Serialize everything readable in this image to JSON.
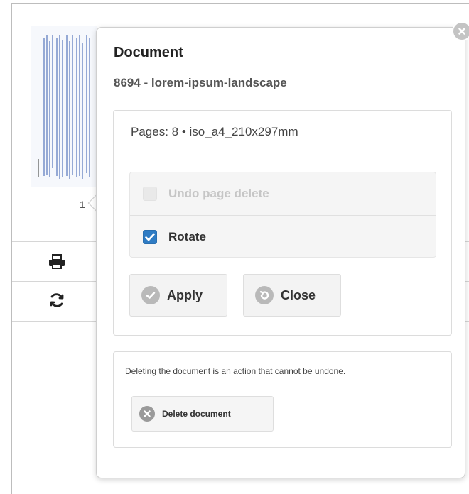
{
  "viewer": {
    "page_indicator": "1",
    "icons": {
      "print": "print-icon",
      "refresh": "refresh-icon"
    }
  },
  "popover": {
    "title": "Document",
    "subtitle": "8694 - lorem-ipsum-landscape",
    "info": "Pages: 8 • iso_a4_210x297mm",
    "options": [
      {
        "label": "Undo page delete",
        "checked": false,
        "disabled": true
      },
      {
        "label": "Rotate",
        "checked": true,
        "disabled": false
      }
    ],
    "apply_label": "Apply",
    "close_label": "Close",
    "warning": "Deleting the document is an action that cannot be undone.",
    "delete_label": "Delete document"
  },
  "colors": {
    "checkbox_checked": "#2f7cc4",
    "button_bg": "#f3f3f3",
    "icon_grey": "#b9b9b9",
    "thumbnail_text": "#3a5fb0"
  }
}
